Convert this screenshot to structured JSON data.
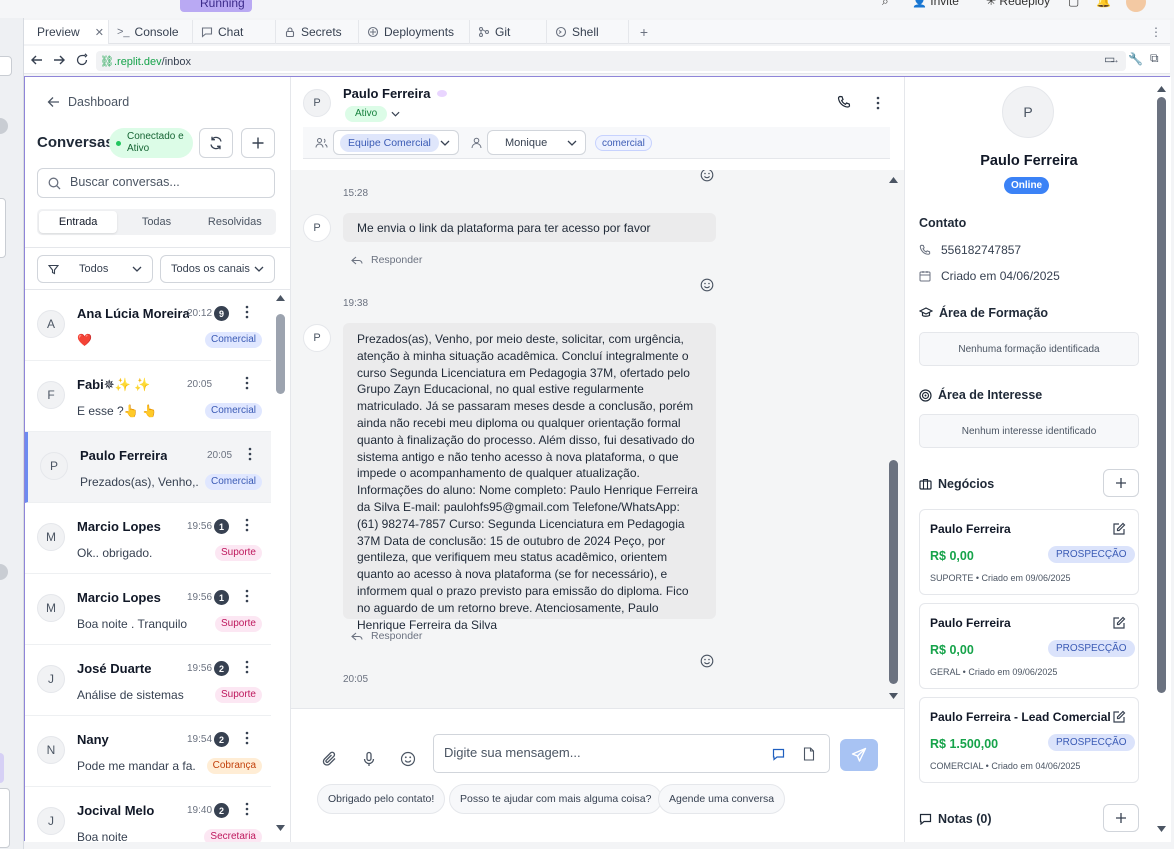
{
  "ide": {
    "run_label": "Running",
    "invite_label": "Invite",
    "redeploy_label": "Redeploy"
  },
  "tabs": [
    {
      "label": "Preview",
      "icon": "monitor-icon",
      "active": true
    },
    {
      "label": "Console",
      "icon": "terminal-icon"
    },
    {
      "label": "Chat",
      "icon": "chat-icon"
    },
    {
      "label": "Secrets",
      "icon": "lock-icon"
    },
    {
      "label": "Deployments",
      "icon": "deploy-icon"
    },
    {
      "label": "Git",
      "icon": "git-icon"
    },
    {
      "label": "Shell",
      "icon": "shell-icon"
    }
  ],
  "address": {
    "url_prefix": ".replit.dev",
    "url_path": "/inbox"
  },
  "sidebar": {
    "back_label": "Dashboard",
    "title": "Conversas",
    "status": "Conectado e Ativo",
    "search_placeholder": "Buscar conversas...",
    "segments": [
      "Entrada",
      "Todas",
      "Resolvidas"
    ],
    "active_segment": "Entrada",
    "filter_all": "Todos",
    "filter_channels": "Todos os canais",
    "conversations": [
      {
        "initial": "A",
        "name": "Ana Lúcia Moreira",
        "time": "20:12",
        "unread": "9",
        "preview": "❤️",
        "tag": "Comercial",
        "tag_kind": "comercial"
      },
      {
        "initial": "F",
        "name": "Fabi✵✨ ✨",
        "time": "20:05",
        "unread": "",
        "preview": "E esse ?👆 👆",
        "tag": "Comercial",
        "tag_kind": "comercial"
      },
      {
        "initial": "P",
        "name": "Paulo Ferreira",
        "time": "20:05",
        "unread": "",
        "preview": "Prezados(as), Venho,...",
        "tag": "Comercial",
        "tag_kind": "comercial",
        "selected": true
      },
      {
        "initial": "M",
        "name": "Marcio Lopes",
        "time": "19:56",
        "unread": "1",
        "preview": "Ok.. obrigado.",
        "tag": "Suporte",
        "tag_kind": "suporte"
      },
      {
        "initial": "M",
        "name": "Marcio Lopes",
        "time": "19:56",
        "unread": "1",
        "preview": "Boa noite . Tranquilo",
        "tag": "Suporte",
        "tag_kind": "suporte"
      },
      {
        "initial": "J",
        "name": "José Duarte",
        "time": "19:56",
        "unread": "2",
        "preview": "Análise de sistemas",
        "tag": "Suporte",
        "tag_kind": "suporte"
      },
      {
        "initial": "N",
        "name": "Nany",
        "time": "19:54",
        "unread": "2",
        "preview": "Pode me mandar a fa...",
        "tag": "Cobrança",
        "tag_kind": "cobranca"
      },
      {
        "initial": "J",
        "name": "Jocival Melo",
        "time": "19:40",
        "unread": "2",
        "preview": "Boa noite",
        "tag": "Secretaria",
        "tag_kind": "secretaria"
      }
    ]
  },
  "chat_header": {
    "initial": "P",
    "name": "Paulo Ferreira",
    "status": "Ativo",
    "team": "Equipe Comercial",
    "agent": "Monique",
    "label": "comercial"
  },
  "messages": [
    {
      "time": "15:28"
    },
    {
      "initial": "P",
      "text": "Me envia o link da plataforma para ter acesso por favor",
      "reply": "Responder"
    },
    {
      "time": "19:38"
    },
    {
      "initial": "P",
      "text": "Prezados(as), Venho, por meio deste, solicitar, com urgência, atenção à minha situação acadêmica. Concluí integralmente o curso Segunda Licenciatura em Pedagogia 37M, ofertado pelo Grupo Zayn Educacional, no qual estive regularmente matriculado. Já se passaram meses desde a conclusão, porém ainda não recebi meu diploma ou qualquer orientação formal quanto à finalização do processo. Além disso, fui desativado do sistema antigo e não tenho acesso à nova plataforma, o que impede o acompanhamento de qualquer atualização. Informações do aluno: Nome completo: Paulo Henrique Ferreira da Silva E-mail: paulohfs95@gmail.com Telefone/WhatsApp: (61) 98274-7857 Curso: Segunda Licenciatura em Pedagogia 37M Data de conclusão: 15 de outubro de 2024 Peço, por gentileza, que verifiquem meu status acadêmico, orientem quanto ao acesso à nova plataforma (se for necessário), e informem qual o prazo previsto para emissão do diploma. Fico no aguardo de um retorno breve. Atenciosamente, Paulo Henrique Ferreira da Silva",
      "reply": "Responder"
    },
    {
      "time": "20:05"
    }
  ],
  "composer": {
    "placeholder": "Digite sua mensagem...",
    "quick_replies": [
      "Obrigado pelo contato!",
      "Posso te ajudar com mais alguma coisa?",
      "Agende uma conversa"
    ]
  },
  "contact": {
    "initial": "P",
    "name": "Paulo Ferreira",
    "presence": "Online",
    "section_contact": "Contato",
    "phone": "556182747857",
    "created": "Criado em 04/06/2025",
    "section_training": "Área de Formação",
    "training_empty": "Nenhuma formação identificada",
    "section_interest": "Área de Interesse",
    "interest_empty": "Nenhum interesse identificado",
    "section_deals": "Negócios",
    "deals": [
      {
        "title": "Paulo Ferreira",
        "value": "R$ 0,00",
        "stage": "PROSPECÇÃO",
        "meta": "SUPORTE • Criado em 09/06/2025"
      },
      {
        "title": "Paulo Ferreira",
        "value": "R$ 0,00",
        "stage": "PROSPECÇÃO",
        "meta": "GERAL • Criado em 09/06/2025"
      },
      {
        "title": "Paulo Ferreira - Lead Comercial",
        "value": "R$ 1.500,00",
        "stage": "PROSPECÇÃO",
        "meta": "COMERCIAL • Criado em 04/06/2025"
      }
    ],
    "section_notes": "Notas (0)"
  },
  "colors": {
    "accent": "#3b82f6",
    "success": "#16a34a",
    "frame": "#8f85d8"
  }
}
